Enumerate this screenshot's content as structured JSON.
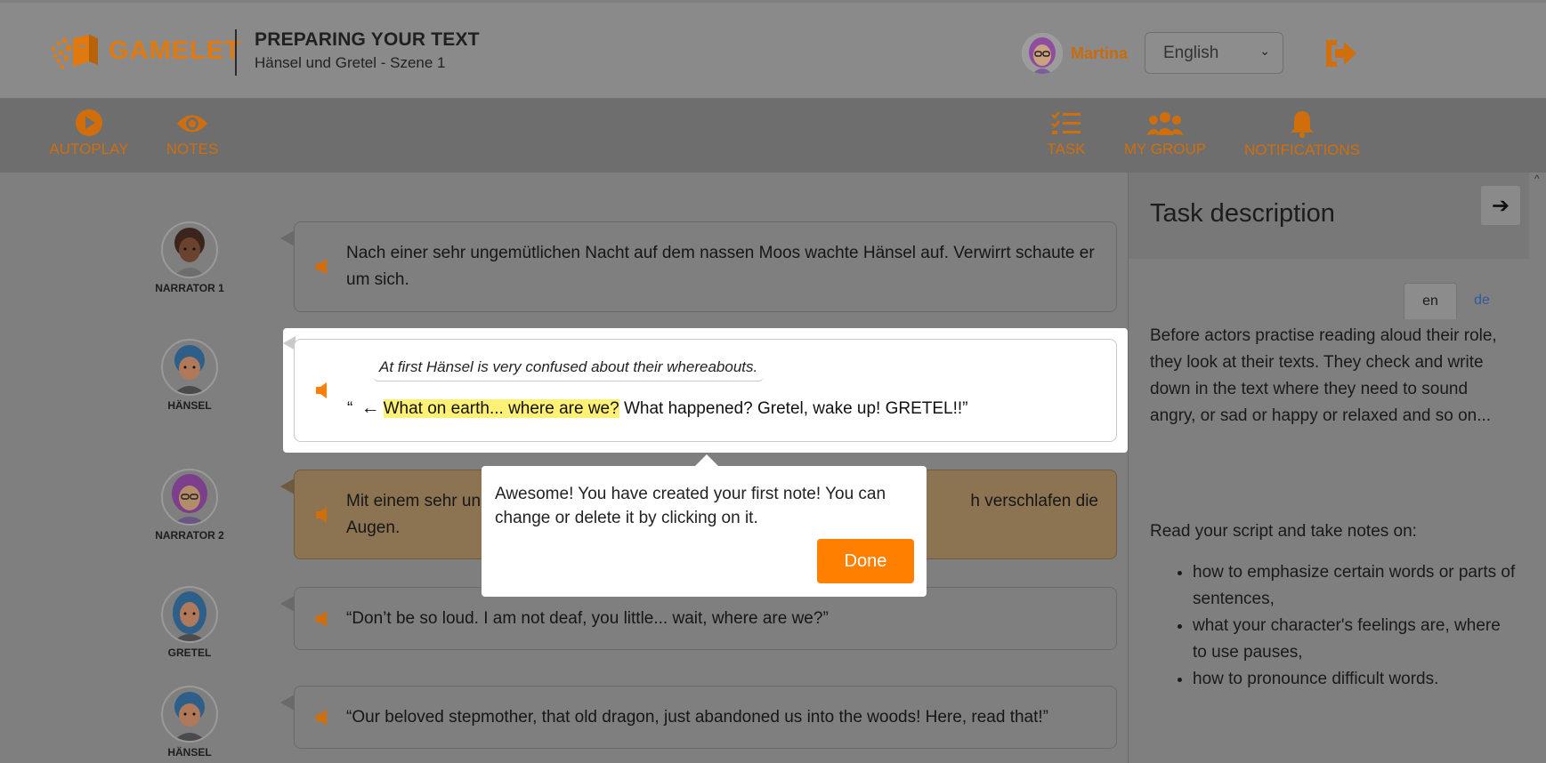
{
  "header": {
    "logo_text": "GAMELET",
    "title": "PREPARING YOUR TEXT",
    "subtitle": "Hänsel und Gretel - Szene 1",
    "user_name": "Martina",
    "language": "English",
    "accent_color": "#e07a10"
  },
  "toolbar": {
    "autoplay": "AUTOPLAY",
    "notes": "NOTES",
    "task": "TASK",
    "my_group": "MY GROUP",
    "notifications": "NOTIFICATIONS"
  },
  "script": {
    "lines": [
      {
        "character": "NARRATOR 1",
        "text": "Nach einer sehr ungemütlichen Nacht auf dem nassen Moos wachte Hänsel auf. Verwirrt schaute er um sich."
      },
      {
        "character": "HÄNSEL",
        "note": "At first Hänsel is very confused about their whereabouts.",
        "quote_open": "“",
        "arrow": "←",
        "highlighted": "What on earth... where are we?",
        "rest": " What happened? Gretel, wake up! GRETEL!!”"
      },
      {
        "character": "NARRATOR 2",
        "text_start": "Mit einem sehr un",
        "text_end": "h verschlafen die",
        "text_line2": "Augen."
      },
      {
        "character": "GRETEL",
        "text": "“Don’t be so loud. I am not deaf, you little... wait, where are we?”"
      },
      {
        "character": "HÄNSEL",
        "text": "“Our beloved stepmother, that old dragon, just abandoned us into the woods! Here, read that!”"
      }
    ]
  },
  "popup": {
    "message": "Awesome! You have created your first note! You can change or delete it by clicking on it.",
    "done_label": "Done",
    "button_color": "#ff8000"
  },
  "task_panel": {
    "title": "Task description",
    "tabs": [
      "en",
      "de"
    ],
    "intro": "Before actors practise reading aloud their role, they look at their texts. They check and write down in the text where they need to sound angry, or sad or happy or relaxed and so on...",
    "instruction": "Read your script and take notes on:",
    "bullets": [
      "how to emphasize certain words or parts of sentences,",
      "what your character's feelings are, where to use pauses,",
      "how to pronounce difficult words."
    ]
  }
}
